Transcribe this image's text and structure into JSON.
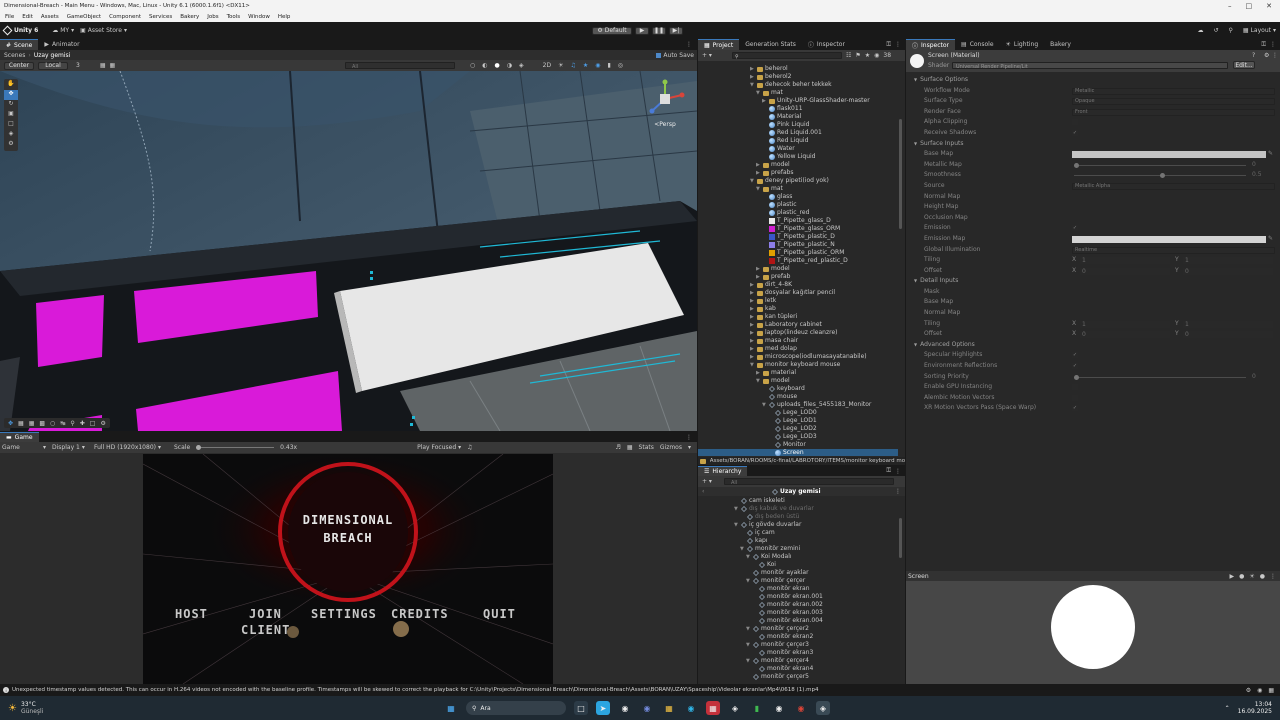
{
  "window": {
    "title": "Dimensional-Breach - Main Menu - Windows, Mac, Linux - Unity 6.1 (6000.1.6f1) <DX11>",
    "menu": [
      "File",
      "Edit",
      "Assets",
      "GameObject",
      "Component",
      "Services",
      "Bakery",
      "Jobs",
      "Tools",
      "Window",
      "Help"
    ]
  },
  "toolbar": {
    "unity_label": "Unity 6",
    "account_label": "MY",
    "store_label": "Asset Store",
    "layout_mode": "Default",
    "layout_label": "Layout"
  },
  "scene": {
    "tabs": [
      "Scene",
      "Animator"
    ],
    "breadcrumb_root": "Scenes",
    "breadcrumb_item": "Uzay gemisi",
    "pivot": "Center",
    "space": "Local",
    "snap": "3",
    "auto_save": "Auto Save",
    "view_label": "<Persp",
    "search_placeholder": "All"
  },
  "game": {
    "tab": "Game",
    "mode": "Game",
    "display": "Display 1",
    "resolution": "Full HD (1920x1080)",
    "scale_label": "Scale",
    "scale_value": "0.43x",
    "play_focused": "Play Focused",
    "stats": "Stats",
    "gizmos": "Gizmos",
    "title_line1": "DIMENSIONAL",
    "title_line2": "BREACH",
    "buttons": {
      "host": "HOST",
      "join": "JOIN",
      "client": "CLIENT",
      "settings": "SETTINGS",
      "credits": "CREDITS",
      "quit": "QUIT"
    }
  },
  "project": {
    "tabs": [
      "Project",
      "Generation Stats",
      "Inspector"
    ],
    "path": "Assets/BORAN/ROOMS/c-final/LABROTORY/ITEMS/monitor keyboard mouse",
    "search_count": "38",
    "tree": [
      {
        "d": 2,
        "t": "folder",
        "l": "beherol"
      },
      {
        "d": 2,
        "t": "folder",
        "l": "beherol2"
      },
      {
        "d": 2,
        "t": "folder",
        "l": "dehecok beher tekkek",
        "open": true
      },
      {
        "d": 3,
        "t": "folder",
        "l": "mat",
        "open": true
      },
      {
        "d": 4,
        "t": "folder",
        "l": "Unity-URP-GlassShader-master"
      },
      {
        "d": 4,
        "t": "mat",
        "l": "flask011"
      },
      {
        "d": 4,
        "t": "mat",
        "l": "Material"
      },
      {
        "d": 4,
        "t": "mat",
        "l": "Pink Liquid"
      },
      {
        "d": 4,
        "t": "mat",
        "l": "Red Liquid.001"
      },
      {
        "d": 4,
        "t": "mat",
        "l": "Red Liquid"
      },
      {
        "d": 4,
        "t": "mat",
        "l": "Water"
      },
      {
        "d": 4,
        "t": "mat",
        "l": "Yellow Liquid"
      },
      {
        "d": 3,
        "t": "folder",
        "l": "model"
      },
      {
        "d": 3,
        "t": "folder",
        "l": "prefabs"
      },
      {
        "d": 2,
        "t": "folder",
        "l": "deney pipeti(iod yok)",
        "open": true
      },
      {
        "d": 3,
        "t": "folder",
        "l": "mat",
        "open": true
      },
      {
        "d": 4,
        "t": "mat",
        "l": "glass"
      },
      {
        "d": 4,
        "t": "mat",
        "l": "plastic"
      },
      {
        "d": 4,
        "t": "mat",
        "l": "plastic_red"
      },
      {
        "d": 4,
        "t": "tex",
        "l": "T_Pipette_glass_D",
        "c": "#e8e8e8"
      },
      {
        "d": 4,
        "t": "tex",
        "l": "T_Pipette_glass_ORM",
        "c": "#d01fd0"
      },
      {
        "d": 4,
        "t": "tex",
        "l": "T_Pipette_plastic_D",
        "c": "#3b56c8"
      },
      {
        "d": 4,
        "t": "tex",
        "l": "T_Pipette_plastic_N",
        "c": "#8d7ee8"
      },
      {
        "d": 4,
        "t": "tex",
        "l": "T_Pipette_plastic_ORM",
        "c": "#e0a000"
      },
      {
        "d": 4,
        "t": "tex",
        "l": "T_Pipette_red_plastic_D",
        "c": "#b01515"
      },
      {
        "d": 3,
        "t": "folder",
        "l": "model"
      },
      {
        "d": 3,
        "t": "folder",
        "l": "prefab"
      },
      {
        "d": 2,
        "t": "folder",
        "l": "dirt_4-8K"
      },
      {
        "d": 2,
        "t": "folder",
        "l": "dosyalar kağıtlar pencil"
      },
      {
        "d": 2,
        "t": "folder",
        "l": "letk"
      },
      {
        "d": 2,
        "t": "folder",
        "l": "kab"
      },
      {
        "d": 2,
        "t": "folder",
        "l": "kan tüpleri"
      },
      {
        "d": 2,
        "t": "folder",
        "l": "Laboratory cabinet"
      },
      {
        "d": 2,
        "t": "folder",
        "l": "laptop(lindeuz cleanzre)"
      },
      {
        "d": 2,
        "t": "folder",
        "l": "masa chair"
      },
      {
        "d": 2,
        "t": "folder",
        "l": "med dolap"
      },
      {
        "d": 2,
        "t": "folder",
        "l": "microscope(iodlumasayatanabile)"
      },
      {
        "d": 2,
        "t": "folder",
        "l": "monitor keyboard mouse",
        "open": true
      },
      {
        "d": 3,
        "t": "folder",
        "l": "material"
      },
      {
        "d": 3,
        "t": "folder",
        "l": "model",
        "open": true
      },
      {
        "d": 4,
        "t": "cube",
        "l": "keyboard"
      },
      {
        "d": 4,
        "t": "cube",
        "l": "mouse"
      },
      {
        "d": 4,
        "t": "cube",
        "l": "uploads_files_5455183_Monitor",
        "open": true
      },
      {
        "d": 5,
        "t": "cube",
        "l": "Lege_LOD0"
      },
      {
        "d": 5,
        "t": "cube",
        "l": "Lege_LOD1"
      },
      {
        "d": 5,
        "t": "cube",
        "l": "Lege_LOD2"
      },
      {
        "d": 5,
        "t": "cube",
        "l": "Lege_LOD3"
      },
      {
        "d": 5,
        "t": "cube",
        "l": "Monitor"
      },
      {
        "d": 5,
        "t": "mat",
        "l": "Screen",
        "sel": true
      }
    ]
  },
  "hierarchy": {
    "tab": "Hierarchy",
    "search_placeholder": "All",
    "scene_name": "Uzay gemisi",
    "items": [
      {
        "d": 1,
        "l": "cam iskeleti"
      },
      {
        "d": 1,
        "l": "dış kabuk ve duvarlar",
        "dim": true,
        "open": true
      },
      {
        "d": 2,
        "l": "dış beden üstü",
        "dim": true
      },
      {
        "d": 1,
        "l": "iç gövde duvarlar",
        "open": true
      },
      {
        "d": 2,
        "l": "iç cam"
      },
      {
        "d": 2,
        "l": "kapı"
      },
      {
        "d": 2,
        "l": "monitör zemini",
        "open": true
      },
      {
        "d": 3,
        "l": "Koi Modalı",
        "open": true
      },
      {
        "d": 4,
        "l": "Koi"
      },
      {
        "d": 3,
        "l": "monitör ayaklar"
      },
      {
        "d": 3,
        "l": "monitör çerçer",
        "open": true
      },
      {
        "d": 4,
        "l": "monitör ekran"
      },
      {
        "d": 4,
        "l": "monitör ekran.001"
      },
      {
        "d": 4,
        "l": "monitör ekran.002"
      },
      {
        "d": 4,
        "l": "monitör ekran.003"
      },
      {
        "d": 4,
        "l": "monitör ekran.004"
      },
      {
        "d": 3,
        "l": "monitör çerçer2",
        "open": true
      },
      {
        "d": 4,
        "l": "monitör ekran2"
      },
      {
        "d": 3,
        "l": "monitör çerçer3",
        "open": true
      },
      {
        "d": 4,
        "l": "monitör ekran3"
      },
      {
        "d": 3,
        "l": "monitör çerçer4",
        "open": true
      },
      {
        "d": 4,
        "l": "monitör ekran4"
      },
      {
        "d": 3,
        "l": "monitör çerçer5"
      }
    ]
  },
  "inspector": {
    "tabs": [
      "Inspector",
      "Console",
      "Lighting",
      "Bakery"
    ],
    "material_name": "Screen (Material)",
    "shader_label": "Shader",
    "shader_value": "Universal Render Pipeline/Lit",
    "edit_label": "Edit...",
    "rows": [
      {
        "l": "Surface Options",
        "h": true
      },
      {
        "l": "Workflow Mode",
        "v": "Metallic"
      },
      {
        "l": "Surface Type",
        "v": "Opaque"
      },
      {
        "l": "Render Face",
        "v": "Front"
      },
      {
        "l": "Alpha Clipping",
        "c": ""
      },
      {
        "l": "Receive Shadows",
        "c": "✓"
      },
      {
        "l": "Surface Inputs",
        "h": true
      },
      {
        "l": "Base Map",
        "sw": "#ececec"
      },
      {
        "l": "Metallic Map",
        "s": "0"
      },
      {
        "l": "Smoothness",
        "s": "0.5"
      },
      {
        "l": "Source",
        "v": "Metallic Alpha"
      },
      {
        "l": "Normal Map"
      },
      {
        "l": "Height Map"
      },
      {
        "l": "Occlusion Map"
      },
      {
        "l": "Emission",
        "c": "✓"
      },
      {
        "l": "Emission Map",
        "sw": "#ffffff"
      },
      {
        "l": "Global Illumination",
        "v": "Realtime"
      },
      {
        "l": "Tiling",
        "xy": [
          "1",
          "1"
        ]
      },
      {
        "l": "Offset",
        "xy": [
          "0",
          "0"
        ]
      },
      {
        "l": "Detail Inputs",
        "h": true
      },
      {
        "l": "Mask"
      },
      {
        "l": "Base Map"
      },
      {
        "l": "Normal Map"
      },
      {
        "l": "Tiling",
        "xy": [
          "1",
          "1"
        ]
      },
      {
        "l": "Offset",
        "xy": [
          "0",
          "0"
        ]
      },
      {
        "l": "Advanced Options",
        "h": true
      },
      {
        "l": "Specular Highlights",
        "c": "✓"
      },
      {
        "l": "Environment Reflections",
        "c": "✓"
      },
      {
        "l": "Sorting Priority",
        "s": "0"
      },
      {
        "l": "Enable GPU Instancing",
        "c": ""
      },
      {
        "l": "Alembic Motion Vectors",
        "c": ""
      },
      {
        "l": "XR Motion Vectors Pass (Space Warp)",
        "c": "✓"
      }
    ],
    "preview_title": "Screen"
  },
  "status": {
    "message": "Unexpected timestamp values detected. This can occur in H.264 videos not encoded with the baseline profile. Timestamps will be skewed to correct the playback for C:\\Unity\\Projects\\Dimensional Breach\\Dimensional-Breach\\Assets\\BORAN\\UZAY\\Spaceship\\Videolar ekranlar\\Mp4\\0618 (1).mp4"
  },
  "taskbar": {
    "weather_temp": "33°C",
    "weather_desc": "Güneşli",
    "search": "Ara",
    "time": "13:04",
    "date": "16.09.2025"
  },
  "colors": {
    "accent": "#3a79bb",
    "magenta": "#d91ad9",
    "panel": "#282828",
    "header": "#3c3c3c"
  }
}
